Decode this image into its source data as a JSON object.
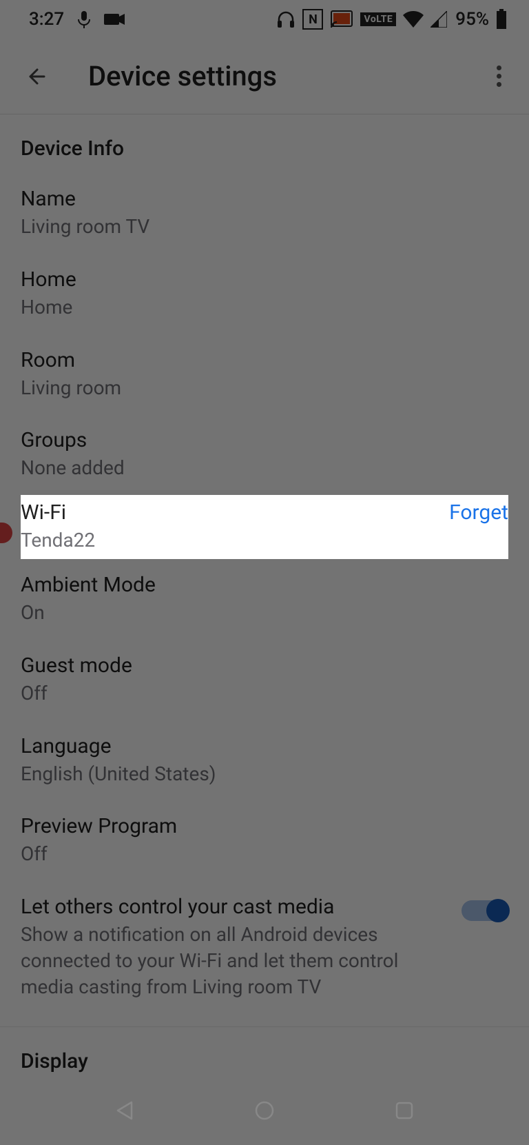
{
  "status": {
    "time": "3:27",
    "battery": "95%",
    "icons": {
      "mic": "mic",
      "camera": "camera",
      "headphones": "headphones",
      "nfc": "N",
      "cast": "cast",
      "volte": "VoLTE",
      "wifi": "wifi",
      "cell": "cell",
      "battery": "battery"
    }
  },
  "appbar": {
    "title": "Device settings",
    "back": "back",
    "more": "more"
  },
  "sections": {
    "deviceInfo": {
      "header": "Device Info",
      "name": {
        "title": "Name",
        "value": "Living room TV"
      },
      "home": {
        "title": "Home",
        "value": "Home"
      },
      "room": {
        "title": "Room",
        "value": "Living room"
      },
      "groups": {
        "title": "Groups",
        "value": "None added"
      },
      "wifi": {
        "title": "Wi-Fi",
        "value": "Tenda22",
        "forget": "Forget"
      },
      "ambient": {
        "title": "Ambient Mode",
        "value": "On"
      },
      "guest": {
        "title": "Guest mode",
        "value": "Off"
      },
      "language": {
        "title": "Language",
        "value": "English (United States)"
      },
      "preview": {
        "title": "Preview Program",
        "value": "Off"
      },
      "castControl": {
        "title": "Let others control your cast media",
        "sub": "Show a notification on all Android devices connected to your Wi-Fi and let them control media casting from Living room TV",
        "toggle": true
      }
    },
    "display": {
      "header": "Display"
    }
  },
  "nav": {
    "back": "back",
    "home": "home",
    "recent": "recent"
  }
}
